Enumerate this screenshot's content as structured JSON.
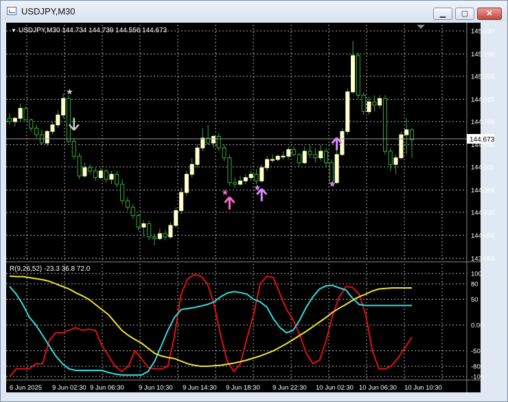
{
  "window": {
    "title": "USDJPY,M30"
  },
  "window_buttons": {
    "minimize": "▁",
    "maximize": "▢",
    "close": "✕"
  },
  "header": {
    "arrow": "▼",
    "text": "USDJPY,M30  144.734 144.739 144.556 144.673"
  },
  "price_axis": {
    "labels": [
      "145.330",
      "145.190",
      "145.055",
      "144.915",
      "144.780",
      "144.640",
      "144.505",
      "144.365",
      "144.230",
      "144.090",
      "143.950"
    ],
    "current_price": "144.673"
  },
  "indicator": {
    "label": "R(9,26,52) -23.3 36.8 72.0",
    "labels": [
      "100",
      "80",
      "50",
      "0.00",
      "-50",
      "-80",
      "-100"
    ]
  },
  "time_axis": {
    "labels": [
      "6 Jun 2025",
      "9 Jun 02:30",
      "9 Jun 06:30",
      "9 Jun 10:30",
      "9 Jun 14:30",
      "9 Jun 18:30",
      "9 Jun 22:30",
      "10 Jun 02:30",
      "10 Jun 06:30",
      "10 Jun 10:30"
    ]
  },
  "colors": {
    "background": "#000000",
    "grid": "#b0b0b0",
    "bull_candle": "#ffffcc",
    "bear_candle": "#3aa93a",
    "wick": "#3aa93a",
    "rsi_fast": "#e01010",
    "rsi_mid": "#33dede",
    "rsi_slow": "#f1e52e",
    "signal_pink": "#ff66cc",
    "signal_violet": "#dd88ff",
    "signal_grey": "#cccccc"
  },
  "chart_data": [
    {
      "type": "candlestick",
      "title": "USDJPY,M30",
      "ylim": [
        143.95,
        145.33
      ],
      "candles": [
        [
          144.8,
          144.83,
          144.76,
          144.78
        ],
        [
          144.78,
          144.81,
          144.75,
          144.8
        ],
        [
          144.8,
          144.89,
          144.78,
          144.86
        ],
        [
          144.86,
          144.87,
          144.79,
          144.79
        ],
        [
          144.79,
          144.8,
          144.72,
          144.74
        ],
        [
          144.74,
          144.76,
          144.68,
          144.7
        ],
        [
          144.7,
          144.73,
          144.64,
          144.65
        ],
        [
          144.65,
          144.73,
          144.63,
          144.72
        ],
        [
          144.72,
          144.78,
          144.7,
          144.76
        ],
        [
          144.76,
          144.85,
          144.74,
          144.82
        ],
        [
          144.82,
          144.95,
          144.8,
          144.92
        ],
        [
          144.92,
          144.94,
          144.65,
          144.66
        ],
        [
          144.66,
          144.68,
          144.55,
          144.57
        ],
        [
          144.57,
          144.59,
          144.43,
          144.45
        ],
        [
          144.45,
          144.53,
          144.44,
          144.5
        ],
        [
          144.5,
          144.52,
          144.46,
          144.48
        ],
        [
          144.48,
          144.5,
          144.42,
          144.44
        ],
        [
          144.44,
          144.5,
          144.43,
          144.48
        ],
        [
          144.48,
          144.49,
          144.41,
          144.43
        ],
        [
          144.43,
          144.48,
          144.4,
          144.46
        ],
        [
          144.46,
          144.48,
          144.38,
          144.4
        ],
        [
          144.4,
          144.43,
          144.28,
          144.3
        ],
        [
          144.3,
          144.32,
          144.24,
          144.26
        ],
        [
          144.26,
          144.28,
          144.19,
          144.21
        ],
        [
          144.21,
          144.22,
          144.12,
          144.14
        ],
        [
          144.14,
          144.18,
          144.08,
          144.16
        ],
        [
          144.16,
          144.18,
          144.06,
          144.08
        ],
        [
          144.08,
          144.1,
          144.03,
          144.07
        ],
        [
          144.07,
          144.13,
          144.06,
          144.1
        ],
        [
          144.1,
          144.12,
          144.06,
          144.08
        ],
        [
          144.08,
          144.17,
          144.07,
          144.15
        ],
        [
          144.15,
          144.26,
          144.14,
          144.24
        ],
        [
          144.24,
          144.38,
          144.22,
          144.35
        ],
        [
          144.35,
          144.48,
          144.33,
          144.46
        ],
        [
          144.46,
          144.56,
          144.44,
          144.52
        ],
        [
          144.52,
          144.64,
          144.5,
          144.62
        ],
        [
          144.62,
          144.74,
          144.6,
          144.68
        ],
        [
          144.68,
          144.76,
          144.64,
          144.65
        ],
        [
          144.65,
          144.7,
          144.62,
          144.69
        ],
        [
          144.69,
          144.71,
          144.6,
          144.62
        ],
        [
          144.62,
          144.64,
          144.54,
          144.56
        ],
        [
          144.56,
          144.58,
          144.39,
          144.41
        ],
        [
          144.41,
          144.44,
          144.38,
          144.4
        ],
        [
          144.4,
          144.45,
          144.39,
          144.42
        ],
        [
          144.42,
          144.46,
          144.4,
          144.44
        ],
        [
          144.44,
          144.48,
          144.42,
          144.46
        ],
        [
          144.46,
          144.49,
          144.4,
          144.42
        ],
        [
          144.42,
          144.52,
          144.41,
          144.5
        ],
        [
          144.5,
          144.57,
          144.48,
          144.55
        ],
        [
          144.55,
          144.58,
          144.53,
          144.55
        ],
        [
          144.55,
          144.58,
          144.54,
          144.57
        ],
        [
          144.57,
          144.6,
          144.55,
          144.57
        ],
        [
          144.57,
          144.63,
          144.55,
          144.61
        ],
        [
          144.61,
          144.63,
          144.57,
          144.58
        ],
        [
          144.58,
          144.59,
          144.51,
          144.53
        ],
        [
          144.53,
          144.63,
          144.52,
          144.6
        ],
        [
          144.6,
          144.64,
          144.56,
          144.58
        ],
        [
          144.58,
          144.62,
          144.53,
          144.56
        ],
        [
          144.56,
          144.64,
          144.54,
          144.6
        ],
        [
          144.6,
          144.62,
          144.5,
          144.53
        ],
        [
          144.53,
          144.55,
          144.39,
          144.41
        ],
        [
          144.41,
          144.62,
          144.4,
          144.58
        ],
        [
          144.58,
          144.74,
          144.57,
          144.72
        ],
        [
          144.72,
          144.98,
          144.7,
          144.96
        ],
        [
          144.96,
          145.27,
          144.95,
          145.18
        ],
        [
          145.18,
          145.2,
          144.92,
          144.94
        ],
        [
          144.94,
          144.96,
          144.82,
          144.84
        ],
        [
          144.84,
          144.93,
          144.82,
          144.9
        ],
        [
          144.9,
          144.94,
          144.84,
          144.88
        ],
        [
          144.88,
          144.94,
          144.86,
          144.92
        ],
        [
          144.92,
          144.94,
          144.58,
          144.6
        ],
        [
          144.6,
          144.62,
          144.48,
          144.52
        ],
        [
          144.52,
          144.58,
          144.46,
          144.56
        ],
        [
          144.56,
          144.72,
          144.55,
          144.7
        ],
        [
          144.7,
          144.8,
          144.58,
          144.73
        ],
        [
          144.73,
          144.74,
          144.56,
          144.67
        ]
      ]
    },
    {
      "type": "line",
      "title": "R(9,26,52)",
      "ylim": [
        -100,
        100
      ],
      "series": [
        {
          "name": "R(9)",
          "values": [
            -100,
            -85,
            -85,
            -85,
            -75,
            -75,
            -30,
            -15,
            -15,
            -10,
            -5,
            -10,
            -8,
            -10,
            -40,
            -60,
            -80,
            -90,
            -80,
            -50,
            -65,
            -82,
            -85,
            -85,
            -80,
            -20,
            60,
            90,
            98,
            95,
            80,
            40,
            -20,
            -70,
            -90,
            -75,
            -25,
            20,
            80,
            95,
            92,
            60,
            30,
            10,
            -20,
            -55,
            -75,
            -68,
            -30,
            20,
            55,
            75,
            73,
            60,
            20,
            -50,
            -85,
            -85,
            -78,
            -62,
            -43,
            -23
          ]
        },
        {
          "name": "R(26)",
          "values": [
            75,
            60,
            40,
            15,
            0,
            -20,
            -40,
            -60,
            -75,
            -85,
            -88,
            -88,
            -88,
            -88,
            -88,
            -92,
            -95,
            -97,
            -97,
            -97,
            -97,
            -90,
            -70,
            -40,
            -10,
            15,
            30,
            32,
            34,
            37,
            40,
            45,
            55,
            62,
            65,
            63,
            60,
            50,
            45,
            35,
            12,
            -5,
            -15,
            -10,
            10,
            35,
            55,
            70,
            76,
            77,
            72,
            68,
            52,
            40,
            38,
            38,
            38,
            38,
            38,
            38,
            38,
            38
          ]
        },
        {
          "name": "R(26,52)",
          "values": [
            95,
            94,
            94,
            92,
            90,
            88,
            85,
            80,
            75,
            70,
            63,
            57,
            50,
            40,
            30,
            20,
            5,
            -10,
            -20,
            -28,
            -35,
            -45,
            -55,
            -60,
            -63,
            -65,
            -70,
            -75,
            -78,
            -80,
            -80,
            -79,
            -78,
            -76,
            -74,
            -71,
            -68,
            -64,
            -60,
            -55,
            -50,
            -43,
            -36,
            -28,
            -20,
            -12,
            -3,
            6,
            15,
            25,
            33,
            40,
            48,
            55,
            60,
            66,
            70,
            71,
            72,
            72,
            72,
            72
          ]
        }
      ]
    }
  ]
}
